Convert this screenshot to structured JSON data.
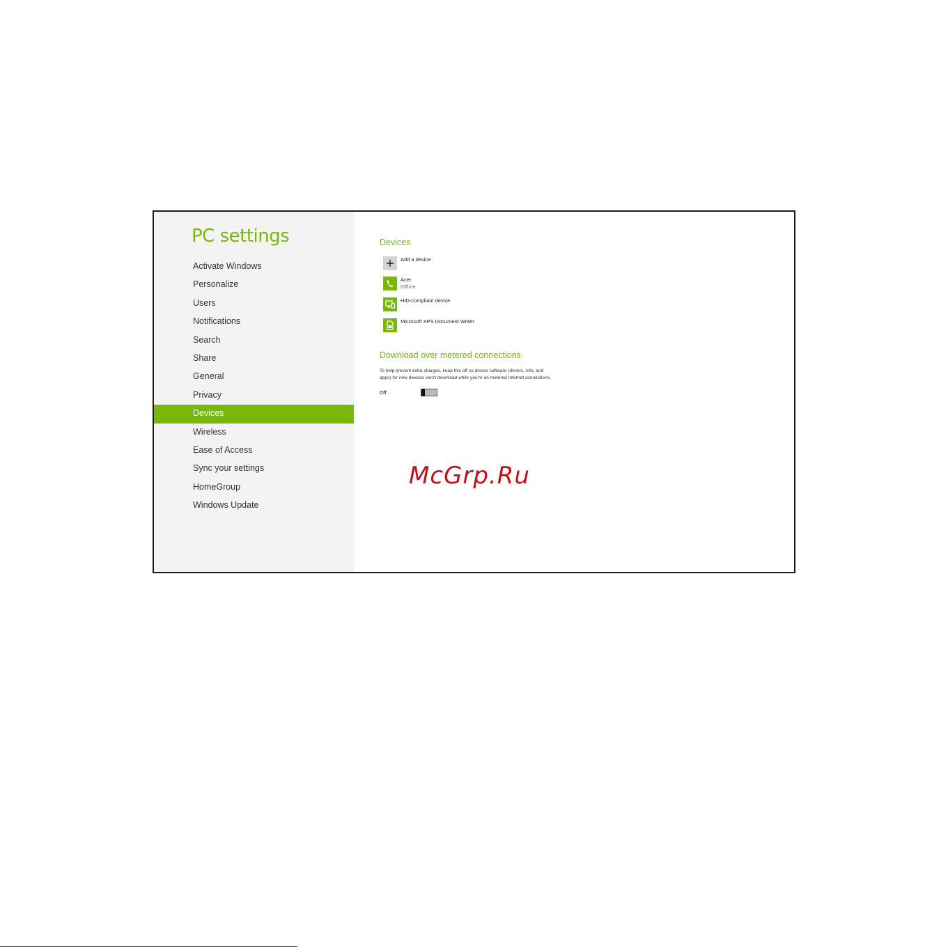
{
  "app": {
    "title": "PC settings"
  },
  "sidebar": {
    "items": [
      {
        "label": "Activate Windows",
        "selected": false
      },
      {
        "label": "Personalize",
        "selected": false
      },
      {
        "label": "Users",
        "selected": false
      },
      {
        "label": "Notifications",
        "selected": false
      },
      {
        "label": "Search",
        "selected": false
      },
      {
        "label": "Share",
        "selected": false
      },
      {
        "label": "General",
        "selected": false
      },
      {
        "label": "Privacy",
        "selected": false
      },
      {
        "label": "Devices",
        "selected": true
      },
      {
        "label": "Wireless",
        "selected": false
      },
      {
        "label": "Ease of Access",
        "selected": false
      },
      {
        "label": "Sync your settings",
        "selected": false
      },
      {
        "label": "HomeGroup",
        "selected": false
      },
      {
        "label": "Windows Update",
        "selected": false
      }
    ]
  },
  "devices": {
    "title": "Devices",
    "add_label": "Add a device",
    "list": [
      {
        "name": "Acer",
        "status": "Offline",
        "icon": "phone-icon"
      },
      {
        "name": "HID-compliant device",
        "status": "",
        "icon": "monitor-device-icon"
      },
      {
        "name": "Microsoft XPS Document Writer",
        "status": "",
        "icon": "printer-document-icon"
      }
    ]
  },
  "metered": {
    "title": "Download over metered connections",
    "description": "To help prevent extra charges, keep this off so device software (drivers, info, and apps) for new devices won't download while you're on metered Internet connections.",
    "toggle_label": "Off",
    "toggle_on": false
  },
  "watermark": {
    "text": "McGrp.Ru"
  },
  "colors": {
    "accent": "#78b80a",
    "sidebar_bg": "#f3f3f3",
    "watermark": "#c1121c"
  }
}
